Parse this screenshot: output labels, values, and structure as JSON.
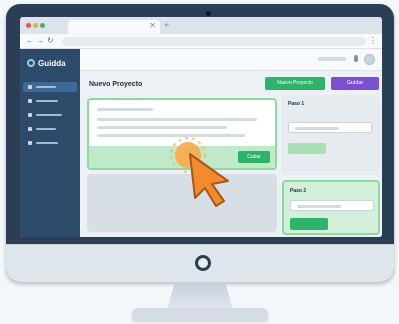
{
  "app": {
    "brand": "Guidda"
  },
  "header": {
    "title": "Nuevo Proyecto"
  },
  "actions": {
    "new_project": "Nuevo Proyecto",
    "guide": "Guidar"
  },
  "card": {
    "button": "Cubar"
  },
  "panels": [
    {
      "label": "Paso 1"
    },
    {
      "label": "Paso 2"
    }
  ],
  "colors": {
    "sidebar": "#2e4a6a",
    "accent_green": "#2fb36a",
    "accent_purple": "#7b4fd0",
    "cursor": "#f28a2e"
  }
}
